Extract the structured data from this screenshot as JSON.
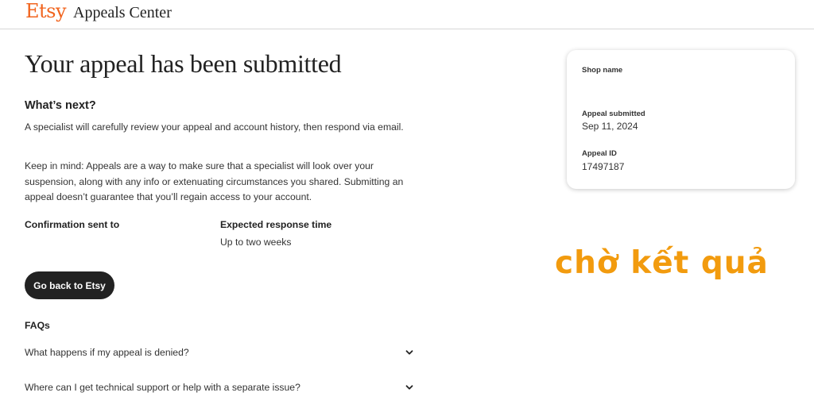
{
  "header": {
    "logo": "Etsy",
    "title": "Appeals Center"
  },
  "main": {
    "title": "Your appeal has been submitted",
    "whats_next": {
      "heading": "What’s next?",
      "paragraph1": "A specialist will carefully review your appeal and account history, then respond via email.",
      "paragraph2": "Keep in mind: Appeals are a way to make sure that a specialist will look over your suspension, along with any info or extenuating circumstances you shared. Submitting an appeal doesn’t guarantee that you’ll regain access to your account."
    },
    "confirmation": {
      "label": "Confirmation sent to",
      "value": ""
    },
    "response_time": {
      "label": "Expected response time",
      "value": "Up to two weeks"
    },
    "back_button": "Go back to Etsy",
    "faqs": {
      "heading": "FAQs",
      "items": [
        {
          "question": "What happens if my appeal is denied?"
        },
        {
          "question": "Where can I get technical support or help with a separate issue?"
        }
      ]
    }
  },
  "card": {
    "shop_name_label": "Shop name",
    "shop_name_value": "",
    "submitted_label": "Appeal submitted",
    "submitted_value": "Sep 11, 2024",
    "id_label": "Appeal ID",
    "id_value": "17497187"
  },
  "overlay": {
    "text": "chờ kết quả"
  },
  "colors": {
    "brand": "#f1641e",
    "button_bg": "#222222",
    "overlay": "#f29b0e"
  },
  "icons": {
    "faq_toggle": "chevron-down-icon"
  }
}
